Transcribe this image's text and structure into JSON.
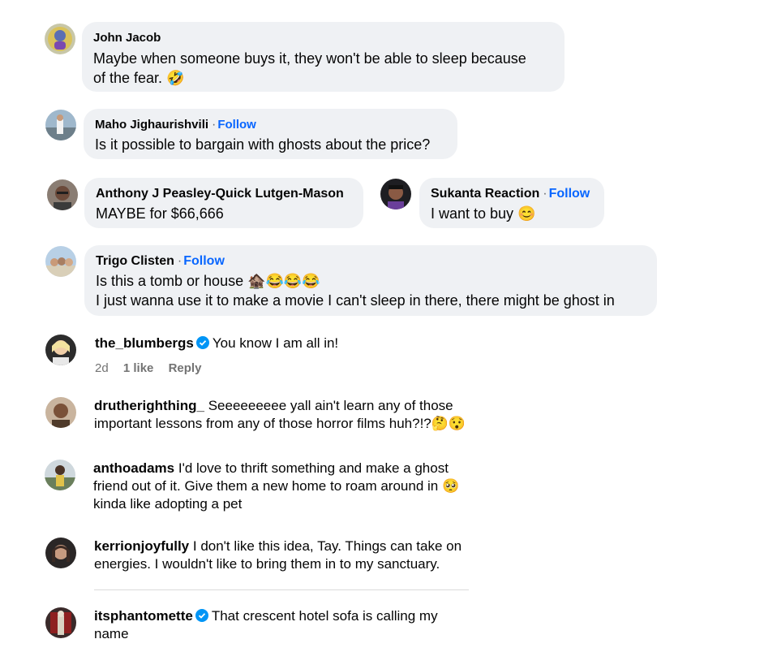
{
  "fb_comments": [
    {
      "name": "John Jacob",
      "follow": "",
      "text": "Maybe when someone buys it, they won't be able to sleep because",
      "text2": "of the fear. 🤣"
    },
    {
      "name": "Maho Jighaurishvili",
      "follow": "Follow",
      "text": "Is it possible to bargain with ghosts about the price?"
    },
    {
      "name": "Anthony J Peasley-Quick Lutgen-Mason",
      "follow": "",
      "text": "MAYBE for $66,666"
    },
    {
      "name": "Sukanta Reaction",
      "follow": "Follow",
      "text": "I want to buy 😊"
    },
    {
      "name": "Trigo Clisten",
      "follow": "Follow",
      "text": "Is this a tomb or house 🏚️😂😂😂",
      "text2": "I just wanna use it to make a movie I can't sleep in there, there might be ghost in"
    }
  ],
  "ig_comments": [
    {
      "user": "the_blumbergs",
      "verified": true,
      "text": "You know I am all in!",
      "meta": {
        "time": "2d",
        "likes": "1 like",
        "reply": "Reply"
      }
    },
    {
      "user": "drutherighthing_",
      "text": "Seeeeeeeee yall ain't learn any of those",
      "text2": "important lessons from any of those horror films huh?!?🤔😯"
    },
    {
      "user": "anthoadams",
      "text": "I'd love to thrift something and make a ghost",
      "text2": "friend out of it. Give them a new home to roam around in 🥺",
      "text3": "kinda like adopting a pet"
    },
    {
      "user": "kerrionjoyfully",
      "text": "I don't like this idea, Tay. Things can take on",
      "text2": "energies. I wouldn't like to bring them in to my sanctuary."
    },
    {
      "user": "itsphantomette",
      "verified": true,
      "text": "That crescent hotel sofa is calling my",
      "text2": "name"
    }
  ],
  "colors": {
    "bubble": "#eff1f4",
    "follow": "#0866ff",
    "verified": "#0095f6",
    "meta": "#737373"
  }
}
